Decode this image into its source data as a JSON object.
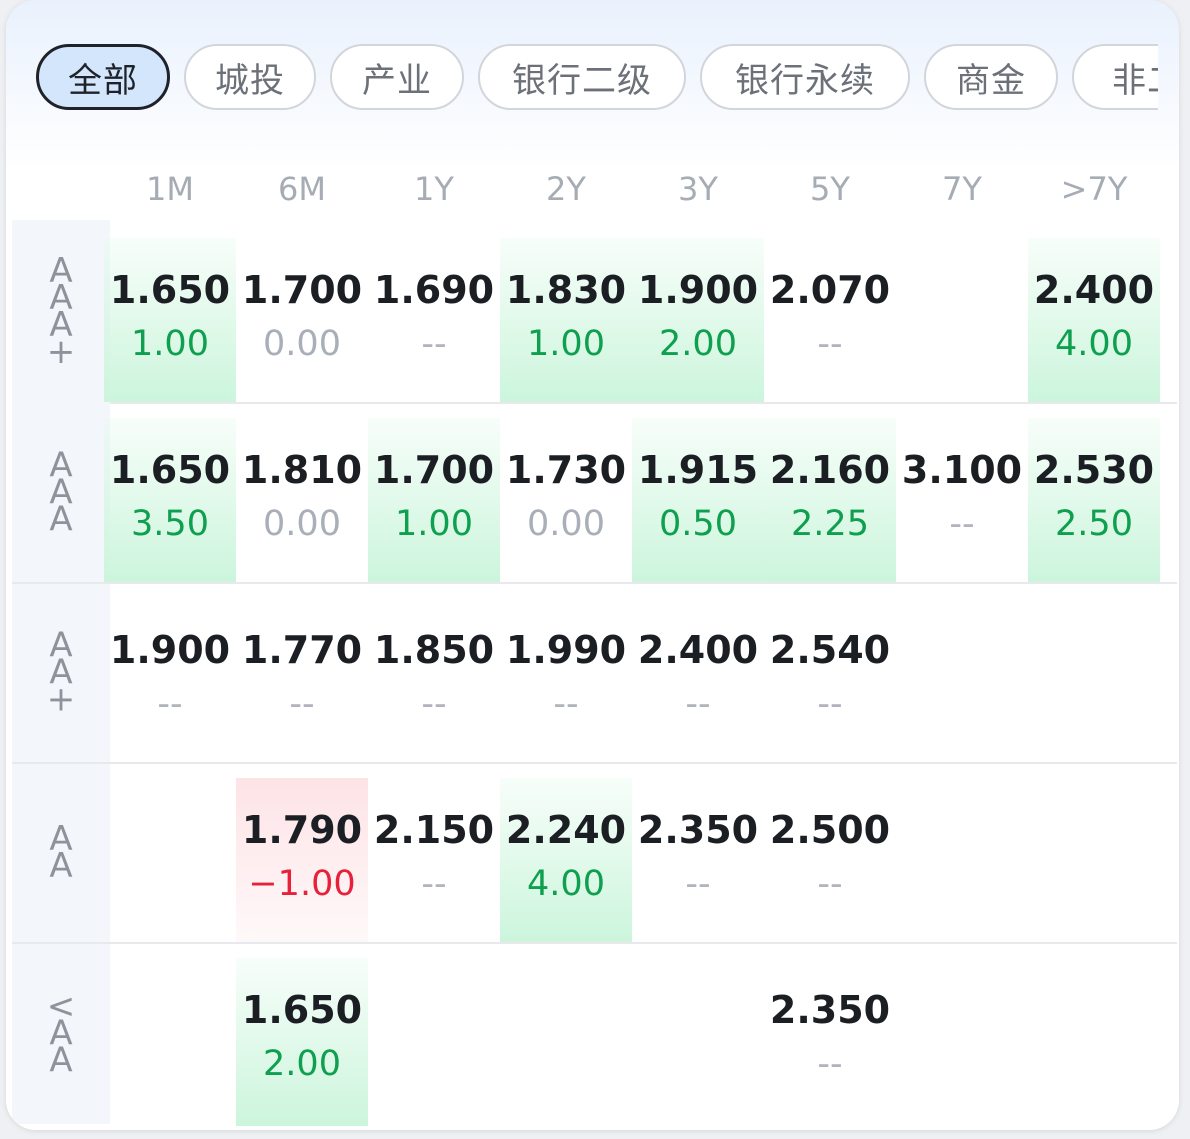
{
  "tabs": [
    {
      "label": "全部",
      "active": true
    },
    {
      "label": "城投",
      "active": false
    },
    {
      "label": "产业",
      "active": false
    },
    {
      "label": "银行二级",
      "active": false
    },
    {
      "label": "银行永续",
      "active": false
    },
    {
      "label": "商金",
      "active": false
    },
    {
      "label": "非二",
      "active": false
    }
  ],
  "columns": [
    "1M",
    "6M",
    "1Y",
    "2Y",
    "3Y",
    "5Y",
    "7Y",
    ">7Y"
  ],
  "rows": [
    {
      "rating": "AAA+",
      "cells": [
        {
          "y": "1.650",
          "c": "1.00",
          "t": "pos",
          "hl": "green"
        },
        {
          "y": "1.700",
          "c": "0.00",
          "t": "zero",
          "hl": ""
        },
        {
          "y": "1.690",
          "c": "--",
          "t": "dash",
          "hl": ""
        },
        {
          "y": "1.830",
          "c": "1.00",
          "t": "pos",
          "hl": "green"
        },
        {
          "y": "1.900",
          "c": "2.00",
          "t": "pos",
          "hl": "green"
        },
        {
          "y": "2.070",
          "c": "--",
          "t": "dash",
          "hl": ""
        },
        null,
        {
          "y": "2.400",
          "c": "4.00",
          "t": "pos",
          "hl": "green"
        }
      ]
    },
    {
      "rating": "AAA",
      "cells": [
        {
          "y": "1.650",
          "c": "3.50",
          "t": "pos",
          "hl": "green"
        },
        {
          "y": "1.810",
          "c": "0.00",
          "t": "zero",
          "hl": ""
        },
        {
          "y": "1.700",
          "c": "1.00",
          "t": "pos",
          "hl": "green"
        },
        {
          "y": "1.730",
          "c": "0.00",
          "t": "zero",
          "hl": ""
        },
        {
          "y": "1.915",
          "c": "0.50",
          "t": "pos",
          "hl": "green"
        },
        {
          "y": "2.160",
          "c": "2.25",
          "t": "pos",
          "hl": "green"
        },
        {
          "y": "3.100",
          "c": "--",
          "t": "dash",
          "hl": ""
        },
        {
          "y": "2.530",
          "c": "2.50",
          "t": "pos",
          "hl": "green"
        }
      ]
    },
    {
      "rating": "AA+",
      "cells": [
        {
          "y": "1.900",
          "c": "--",
          "t": "dash",
          "hl": ""
        },
        {
          "y": "1.770",
          "c": "--",
          "t": "dash",
          "hl": ""
        },
        {
          "y": "1.850",
          "c": "--",
          "t": "dash",
          "hl": ""
        },
        {
          "y": "1.990",
          "c": "--",
          "t": "dash",
          "hl": ""
        },
        {
          "y": "2.400",
          "c": "--",
          "t": "dash",
          "hl": ""
        },
        {
          "y": "2.540",
          "c": "--",
          "t": "dash",
          "hl": ""
        },
        null,
        null
      ]
    },
    {
      "rating": "AA",
      "cells": [
        null,
        {
          "y": "1.790",
          "c": "−1.00",
          "t": "neg",
          "hl": "red"
        },
        {
          "y": "2.150",
          "c": "--",
          "t": "dash",
          "hl": ""
        },
        {
          "y": "2.240",
          "c": "4.00",
          "t": "pos",
          "hl": "green"
        },
        {
          "y": "2.350",
          "c": "--",
          "t": "dash",
          "hl": ""
        },
        {
          "y": "2.500",
          "c": "--",
          "t": "dash",
          "hl": ""
        },
        null,
        null
      ]
    },
    {
      "rating": "<AA",
      "cells": [
        null,
        {
          "y": "1.650",
          "c": "2.00",
          "t": "pos",
          "hl": "green"
        },
        null,
        null,
        null,
        {
          "y": "2.350",
          "c": "--",
          "t": "dash",
          "hl": ""
        },
        null,
        null
      ]
    }
  ],
  "colors": {
    "up": "#0e9f4f",
    "down": "#e8203a",
    "zero": "#a9afb8",
    "active_tab_bg": "#d3e6fb"
  }
}
